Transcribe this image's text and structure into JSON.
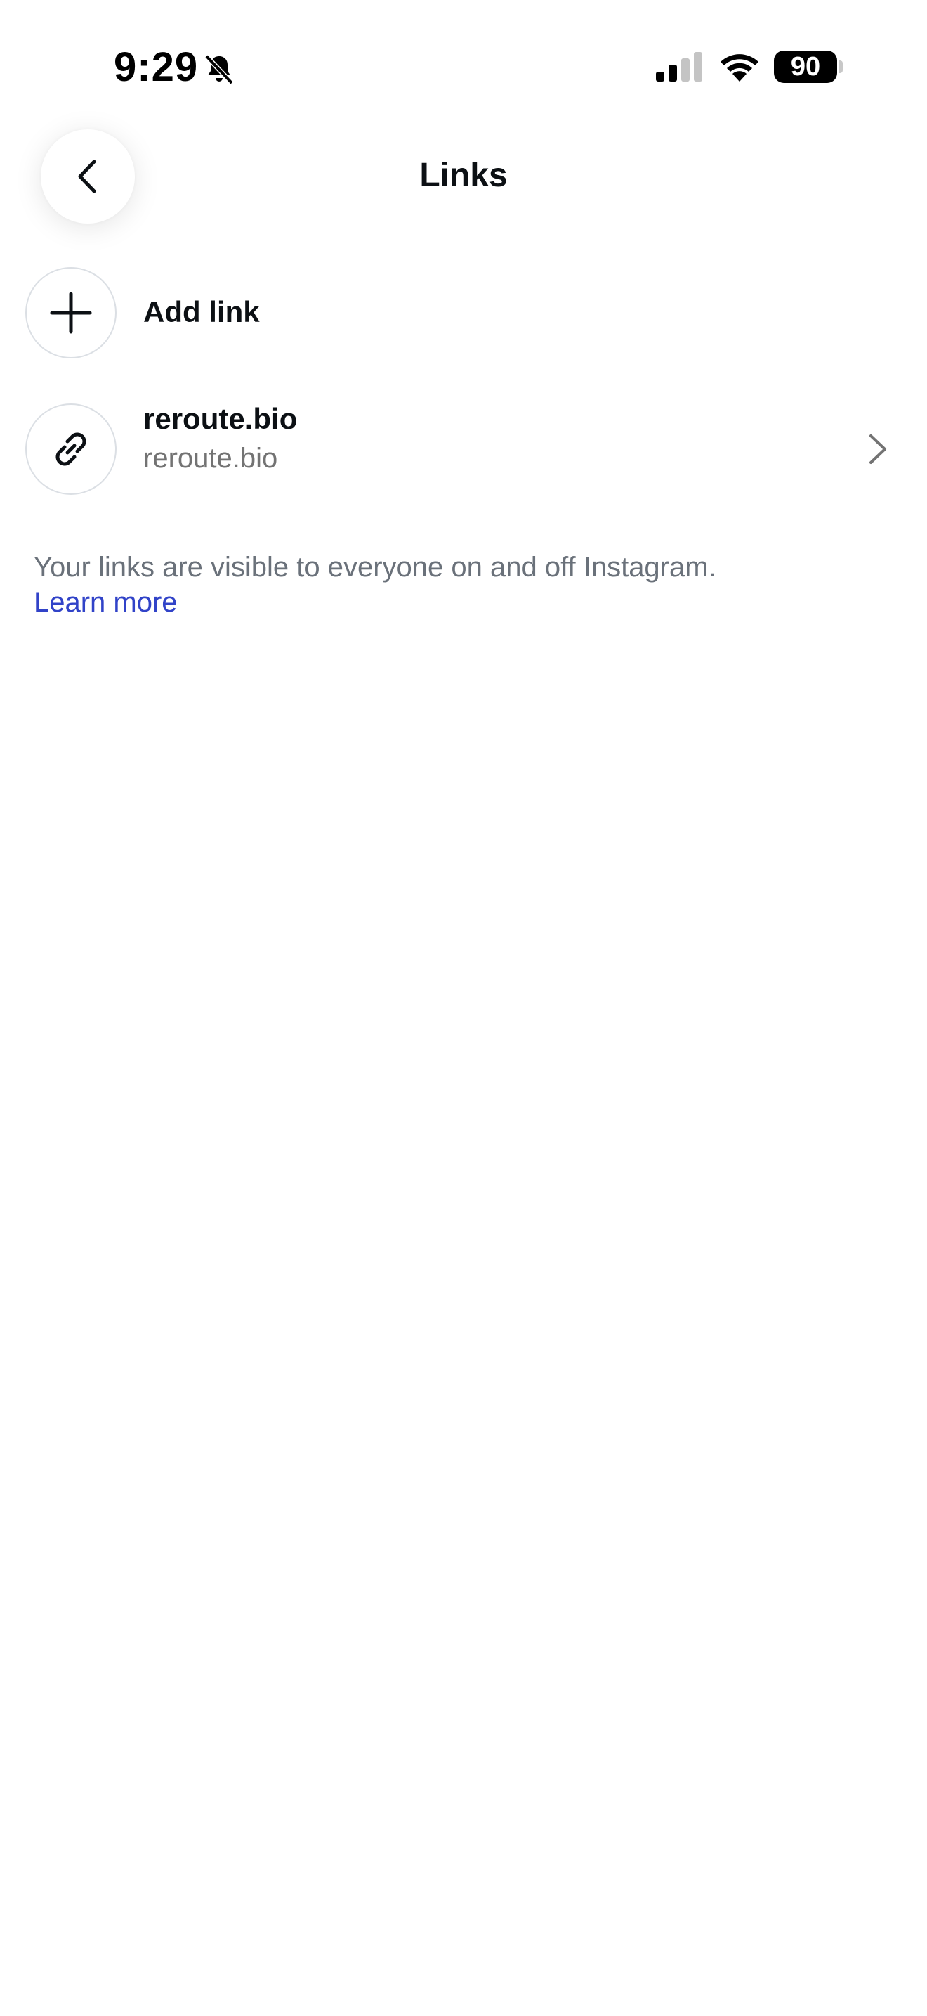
{
  "status_bar": {
    "time": "9:29",
    "battery": "90",
    "icons": [
      "bell-slash-icon",
      "cellular-signal-icon",
      "wifi-icon",
      "battery-icon"
    ]
  },
  "header": {
    "title": "Links",
    "back_icon": "chevron-left-icon"
  },
  "add_link": {
    "label": "Add link",
    "icon": "plus-icon"
  },
  "links": [
    {
      "title": "reroute.bio",
      "url": "reroute.bio",
      "icon": "link-icon",
      "trailing_icon": "chevron-right-icon"
    }
  ],
  "notice": {
    "text": "Your links are visible to everyone on and off Instagram.",
    "learn_more": "Learn more"
  },
  "colors": {
    "text_primary": "#0c1014",
    "text_secondary": "#737373",
    "notice_text": "#6a717a",
    "link_blue": "#3143c8",
    "circle_border": "#dbdfe4",
    "background": "#ffffff"
  }
}
